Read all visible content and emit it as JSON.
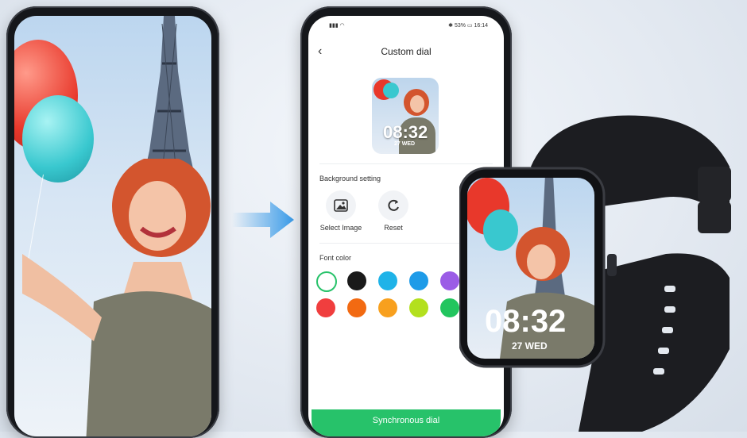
{
  "status_bar": {
    "battery": "53%",
    "time": "16:14"
  },
  "app": {
    "title": "Custom dial",
    "preview_time": "08:32",
    "preview_date": "27 WED",
    "background_setting": {
      "label": "Background setting",
      "buttons": [
        {
          "label": "Select Image",
          "icon": "image-icon"
        },
        {
          "label": "Reset",
          "icon": "refresh-icon"
        }
      ]
    },
    "font_color": {
      "label": "Font color",
      "swatches": [
        "#ffffff",
        "#1a1a1a",
        "#1fb3e8",
        "#1e9be8",
        "#9b5ce6",
        "#f03e3e",
        "#f26a12",
        "#f8a01e",
        "#b3e01e",
        "#22c55e"
      ]
    },
    "sync_label": "Synchronous dial"
  },
  "watch": {
    "time": "08:32",
    "date": "27 WED"
  },
  "colors": {
    "accent": "#27c26a",
    "arrow": "#3a9be8"
  }
}
